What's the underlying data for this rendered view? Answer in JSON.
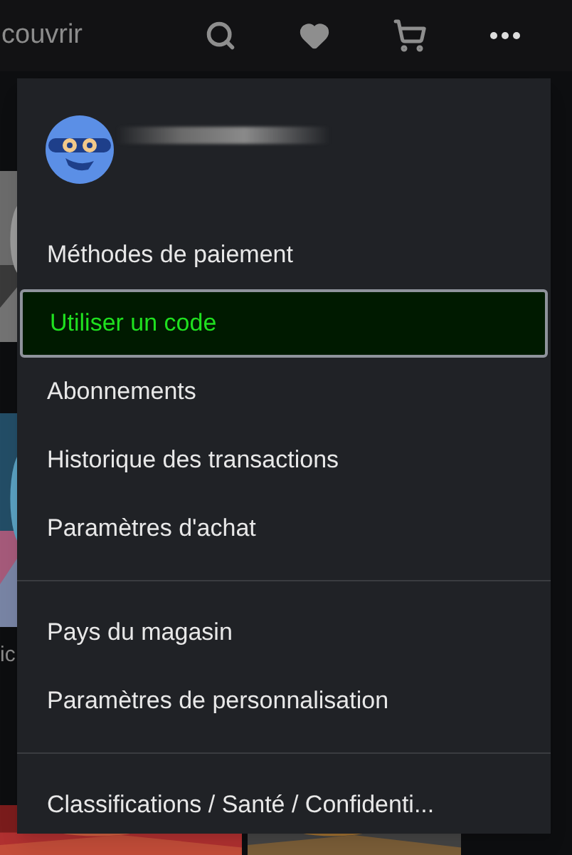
{
  "top_bar": {
    "title": "couvrir"
  },
  "background": {
    "caption": "ic"
  },
  "menu": {
    "sections": [
      {
        "items": [
          {
            "label": "Méthodes de paiement",
            "selected": false
          },
          {
            "label": "Utiliser un code",
            "selected": true
          },
          {
            "label": "Abonnements",
            "selected": false
          },
          {
            "label": "Historique des transactions",
            "selected": false
          },
          {
            "label": "Paramètres d'achat",
            "selected": false
          }
        ]
      },
      {
        "items": [
          {
            "label": "Pays du magasin",
            "selected": false
          },
          {
            "label": "Paramètres de personnalisation",
            "selected": false
          }
        ]
      },
      {
        "items": [
          {
            "label": "Classifications / Santé / Confidenti...",
            "selected": false
          }
        ]
      }
    ]
  }
}
